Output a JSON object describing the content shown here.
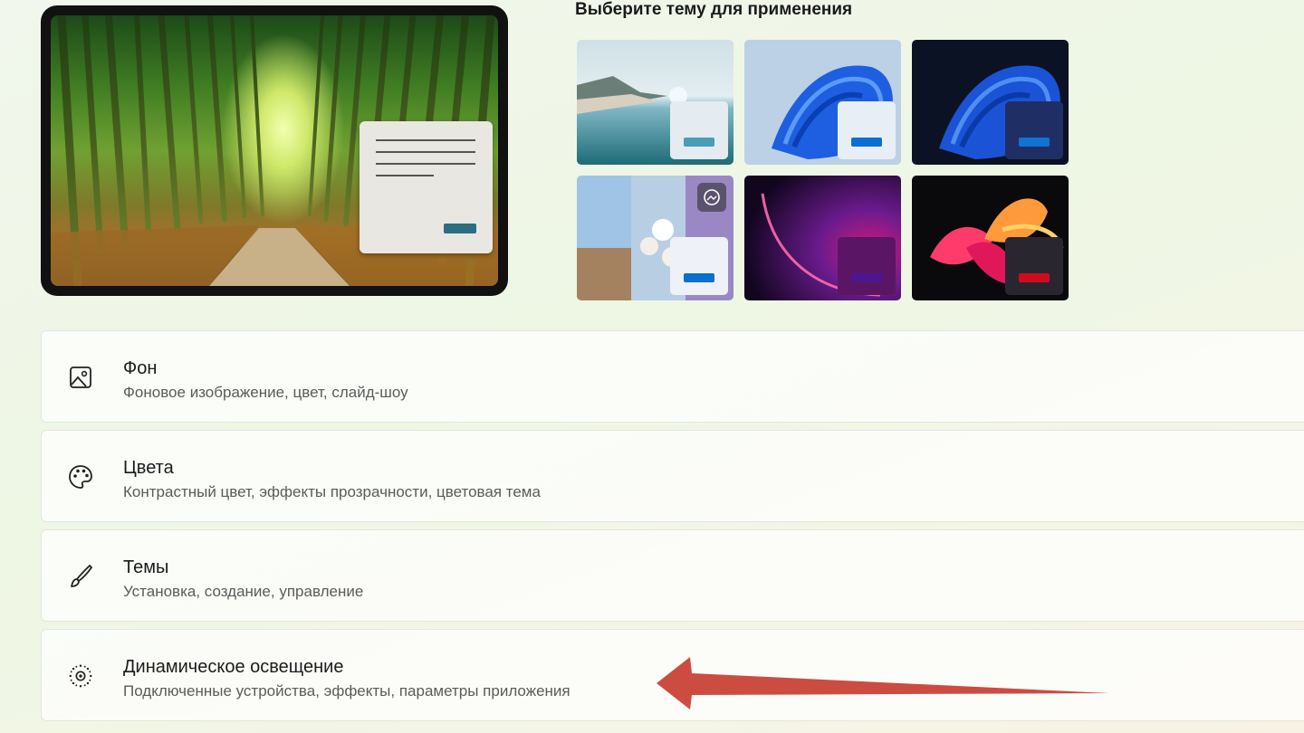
{
  "theme_picker": {
    "heading": "Выберите тему для применения",
    "themes": [
      {
        "id": "glow-lake",
        "icon": "landscape-thumbnail",
        "accent": "#4a9db6",
        "swatch_bg": "#e4ecf1"
      },
      {
        "id": "windows-light",
        "icon": "bloom-light-thumbnail",
        "accent": "#0a6fd1",
        "swatch_bg": "#e8eef6"
      },
      {
        "id": "windows-dark",
        "icon": "bloom-dark-thumbnail",
        "accent": "#1073d4",
        "swatch_bg": "#1f2f66"
      },
      {
        "id": "spotlight",
        "icon": "collage-thumbnail",
        "accent": "#0a6fd1",
        "swatch_bg": "#eef2f8"
      },
      {
        "id": "glow-purple",
        "icon": "purple-glow-thumbnail",
        "accent": "#4d1690",
        "swatch_bg": "#5a1664"
      },
      {
        "id": "flow-dark",
        "icon": "flower-dark-thumbnail",
        "accent": "#d00c1c",
        "swatch_bg": "#2a2630"
      }
    ]
  },
  "settings": [
    {
      "title": "Фон",
      "subtitle": "Фоновое изображение, цвет, слайд-шоу",
      "icon": "image-icon"
    },
    {
      "title": "Цвета",
      "subtitle": "Контрастный цвет, эффекты прозрачности, цветовая тема",
      "icon": "palette-icon"
    },
    {
      "title": "Темы",
      "subtitle": "Установка, создание, управление",
      "icon": "brush-icon"
    },
    {
      "title": "Динамическое освещение",
      "subtitle": "Подключенные устройства, эффекты, параметры приложения",
      "icon": "dynamic-lighting-icon"
    }
  ],
  "annotation": {
    "arrow_color": "#cd4c41"
  }
}
